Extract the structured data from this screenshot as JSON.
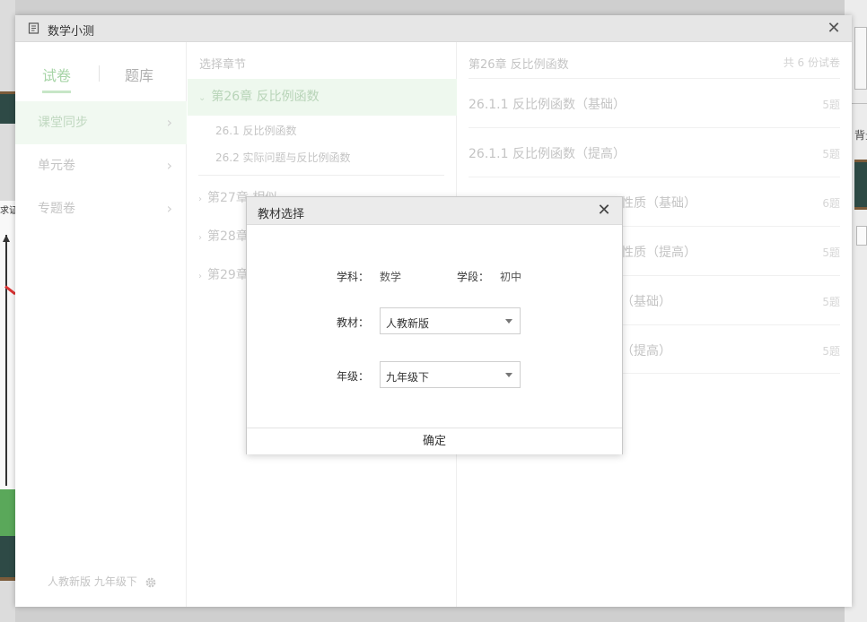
{
  "background": {
    "right_text": "背景",
    "left_label": "求证"
  },
  "window": {
    "title": "数学小测"
  },
  "left": {
    "tabs": [
      {
        "label": "试卷",
        "active": true
      },
      {
        "label": "题库",
        "active": false
      }
    ],
    "nav": [
      {
        "label": "课堂同步",
        "active": true
      },
      {
        "label": "单元卷",
        "active": false
      },
      {
        "label": "专题卷",
        "active": false
      }
    ],
    "footer": "人教新版 九年级下"
  },
  "middle": {
    "header": "选择章节",
    "active_chapter": "第26章 反比例函数",
    "sub_items": [
      "26.1 反比例函数",
      "26.2 实际问题与反比例函数"
    ],
    "chapters": [
      "第27章 相似",
      "第28章",
      "第29章"
    ]
  },
  "right": {
    "header": "第26章 反比例函数",
    "count": "共 6 份试卷",
    "items": [
      {
        "title": "26.1.1 反比例函数（基础）",
        "count": "5题"
      },
      {
        "title": "26.1.1 反比例函数（提高）",
        "count": "5题"
      },
      {
        "title": "性质（基础）",
        "count": "6题"
      },
      {
        "title": "性质（提高）",
        "count": "5题"
      },
      {
        "title": "（基础）",
        "count": "5题"
      },
      {
        "title": "（提高）",
        "count": "5题"
      }
    ]
  },
  "dialog": {
    "title": "教材选择",
    "subject_label": "学科：",
    "subject_value": "数学",
    "stage_label": "学段：",
    "stage_value": "初中",
    "textbook_label": "教材：",
    "textbook_value": "人教新版",
    "grade_label": "年级：",
    "grade_value": "九年级下",
    "confirm": "确定"
  },
  "colors": {
    "accent_green": "#a6d4a6",
    "active_bg": "#eef8ee",
    "titlebar": "#e6e6e6"
  }
}
